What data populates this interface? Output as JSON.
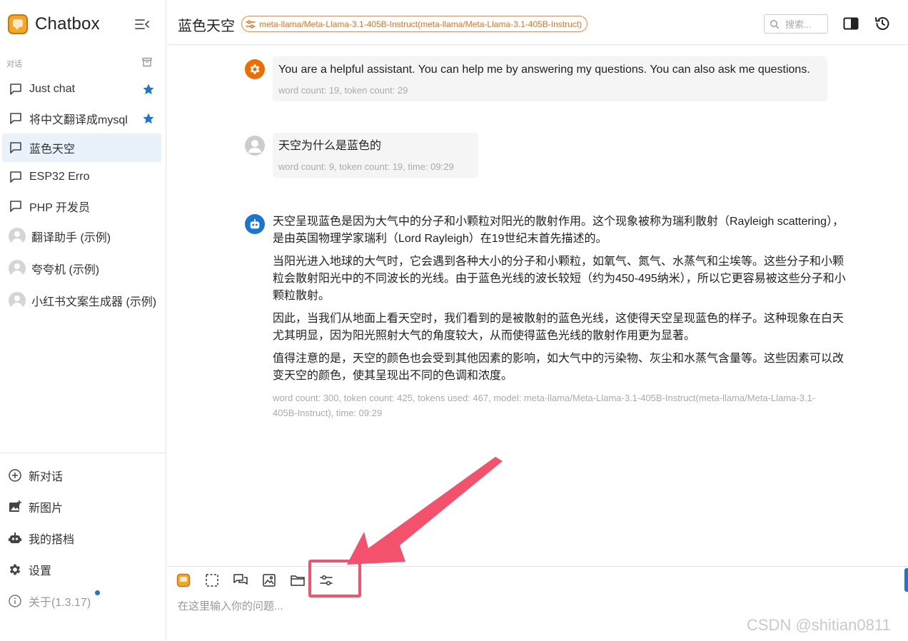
{
  "app": {
    "name": "Chatbox"
  },
  "sidebar": {
    "section_label": "对话",
    "conversations": [
      {
        "label": "Just chat",
        "starred": true
      },
      {
        "label": "将中文翻译成mysql",
        "starred": true
      },
      {
        "label": "蓝色天空",
        "active": true
      },
      {
        "label": "ESP32 Erro"
      },
      {
        "label": "PHP 开发员"
      }
    ],
    "personas": [
      {
        "label": "翻译助手 (示例)"
      },
      {
        "label": "夸夸机 (示例)"
      },
      {
        "label": "小红书文案生成器 (示例)"
      }
    ],
    "bottom": {
      "new_chat": "新对话",
      "new_image": "新图片",
      "my_copilots": "我的搭档",
      "settings": "设置",
      "about": "关于(1.3.17)"
    }
  },
  "header": {
    "title": "蓝色天空",
    "model": "meta-llama/Meta-Llama-3.1-405B-Instruct(meta-llama/Meta-Llama-3.1-405B-Instruct)",
    "search_placeholder": "搜索..."
  },
  "messages": {
    "system": {
      "text": "You are a helpful assistant. You can help me by answering my questions. You can also ask me questions.",
      "meta": "word count: 19, token count: 29"
    },
    "user": {
      "text": "天空为什么是蓝色的",
      "meta": "word count: 9, token count: 19, time: 09:29"
    },
    "assistant": {
      "paragraphs": [
        "天空呈现蓝色是因为大气中的分子和小颗粒对阳光的散射作用。这个现象被称为瑞利散射（Rayleigh scattering），是由英国物理学家瑞利（Lord Rayleigh）在19世纪末首先描述的。",
        "当阳光进入地球的大气时，它会遇到各种大小的分子和小颗粒，如氧气、氮气、水蒸气和尘埃等。这些分子和小颗粒会散射阳光中的不同波长的光线。由于蓝色光线的波长较短（约为450-495纳米），所以它更容易被这些分子和小颗粒散射。",
        "因此，当我们从地面上看天空时，我们看到的是被散射的蓝色光线，这使得天空呈现蓝色的样子。这种现象在白天尤其明显，因为阳光照射大气的角度较大，从而使得蓝色光线的散射作用更为显著。",
        "值得注意的是，天空的颜色也会受到其他因素的影响，如大气中的污染物、灰尘和水蒸气含量等。这些因素可以改变天空的颜色，使其呈现出不同的色调和浓度。"
      ],
      "meta": "word count: 300, token count: 425, tokens used: 467, model: meta-llama/Meta-Llama-3.1-405B-Instruct(meta-llama/Meta-Llama-3.1-405B-Instruct), time: 09:29"
    }
  },
  "input": {
    "placeholder": "在这里输入你的问题..."
  },
  "watermark": "CSDN @shitian0811",
  "colors": {
    "accent": "#1976d2",
    "model_chip": "#e8731a",
    "highlight": "#f4516c",
    "system_avatar": "#ef6c00",
    "assistant_avatar": "#1976d2",
    "user_avatar": "#cccccc"
  },
  "icons": {
    "collapse": "collapse-sidebar-icon",
    "archive": "archive-icon",
    "conversation": "chat-bubble-icon",
    "star": "star-icon",
    "settings": "gear-icon",
    "about": "info-icon",
    "new_chat": "plus-circle-icon",
    "new_image": "image-plus-icon",
    "copilot": "robot-icon",
    "layout": "layout-toggle-icon",
    "history": "history-icon",
    "tools": [
      "chatbox-logo-icon",
      "selection-icon",
      "chat-bubbles-icon",
      "image-icon",
      "folder-icon",
      "sliders-icon"
    ]
  }
}
